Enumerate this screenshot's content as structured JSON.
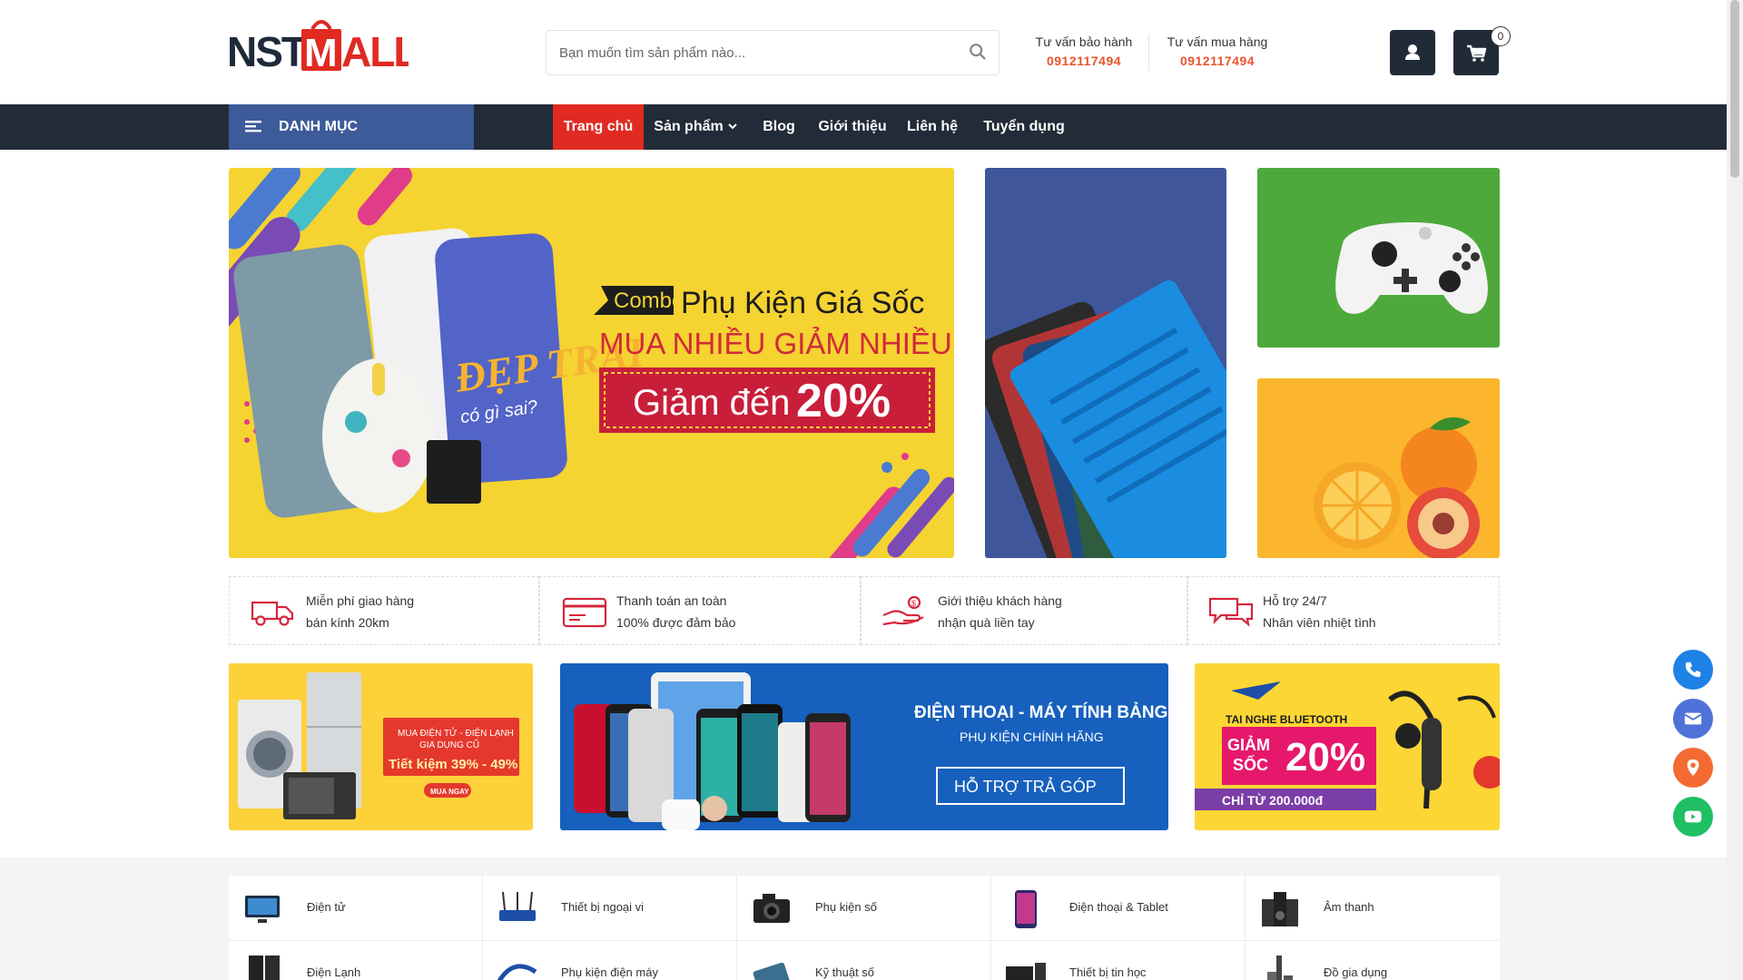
{
  "header": {
    "logo_text": "NSTMALL",
    "search_placeholder": "Bạn muốn tìm sản phẩm nào...",
    "hotlines": [
      {
        "label": "Tư vấn bảo hành",
        "number": "0912117494"
      },
      {
        "label": "Tư vấn mua hàng",
        "number": "0912117494"
      }
    ],
    "cart_count": "0",
    "icons": {
      "search": "search-icon",
      "account": "user-icon",
      "cart": "cart-icon"
    }
  },
  "nav": {
    "category_label": "DANH MỤC",
    "items": [
      {
        "label": "Trang chủ",
        "active": true
      },
      {
        "label": "Sản phẩm",
        "dropdown": true
      },
      {
        "label": "Blog"
      },
      {
        "label": "Giới thiệu"
      },
      {
        "label": "Liên hệ"
      },
      {
        "label": "Tuyển dụng"
      }
    ]
  },
  "hero": {
    "tag": "Combo",
    "title": "Phụ Kiện Giá Sốc",
    "subtitle": "MUA NHIỀU GIẢM NHIỀU",
    "discount_prefix": "Giảm đến",
    "discount_value": "20%",
    "case_text": "ĐẸP TRAI",
    "case_sub": "có gì sai?"
  },
  "policies": [
    {
      "icon": "truck-icon",
      "line1": "Miễn phí giao hàng",
      "line2": "bán kính 20km"
    },
    {
      "icon": "card-icon",
      "line1": "Thanh toán an toàn",
      "line2": "100% được đảm bảo"
    },
    {
      "icon": "hand-gift-icon",
      "line1": "Giới thiệu khách hàng",
      "line2": "nhận quà liền tay"
    },
    {
      "icon": "chat-icon",
      "line1": "Hỗ trợ 24/7",
      "line2": "Nhân viên nhiệt tình"
    }
  ],
  "promos": {
    "left": {
      "line1": "MUA ĐIỆN TỬ - ĐIỆN LẠNH",
      "line2": "GIA DỤNG CŨ",
      "line3": "Tiết kiệm 39% - 49%",
      "button": "MUA NGAY"
    },
    "center": {
      "title": "ĐIỆN THOẠI - MÁY TÍNH BẢNG",
      "subtitle": "PHỤ KIỆN CHÍNH HÃNG",
      "button": "HỖ TRỢ TRẢ GÓP"
    },
    "right": {
      "line1": "TAI NGHE BLUETOOTH",
      "line2": "GIẢM",
      "line3": "SỐC",
      "discount": "20%",
      "price": "CHỈ TỪ 200.000đ"
    }
  },
  "categories": [
    {
      "label": "Điện tử",
      "icon": "tv-icon"
    },
    {
      "label": "Thiết bị ngoại vi",
      "icon": "router-icon"
    },
    {
      "label": "Phụ kiện số",
      "icon": "camera-icon"
    },
    {
      "label": "Điện thoại & Tablet",
      "icon": "phone-icon"
    },
    {
      "label": "Âm thanh",
      "icon": "speaker-icon"
    },
    {
      "label": "Điện Lạnh",
      "icon": "fridge-icon"
    },
    {
      "label": "Phụ kiện điện máy",
      "icon": "cable-icon"
    },
    {
      "label": "Kỹ thuật số",
      "icon": "gadget-icon"
    },
    {
      "label": "Thiết bị tin học",
      "icon": "computer-icon"
    },
    {
      "label": "Đồ gia dụng",
      "icon": "appliance-icon"
    }
  ],
  "floating": [
    "phone-icon",
    "mail-icon",
    "map-pin-icon",
    "youtube-icon"
  ],
  "colors": {
    "nav_bg": "#222b38",
    "category_bg": "#3d5a99",
    "active": "#e02a22",
    "accent": "#e8542e"
  }
}
